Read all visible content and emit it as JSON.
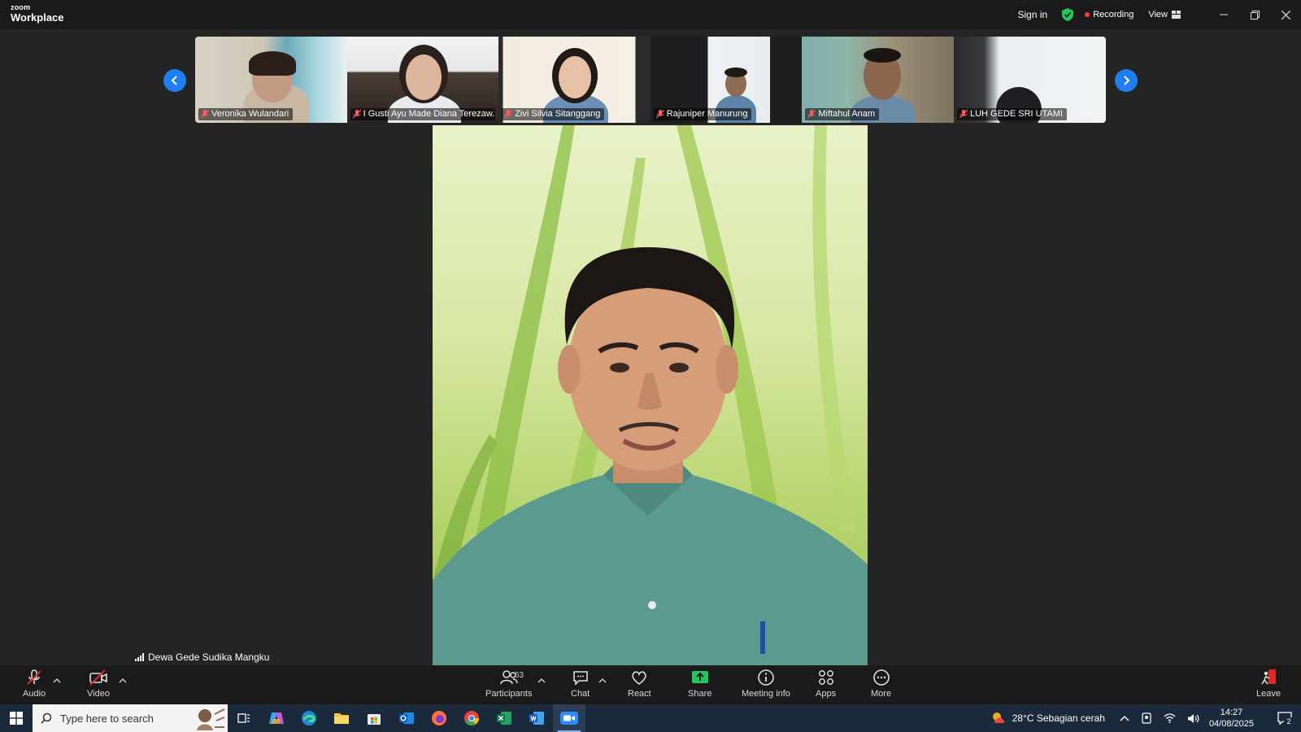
{
  "app": {
    "logo_line1": "zoom",
    "logo_line2": "Workplace"
  },
  "titlebar": {
    "sign_in": "Sign in",
    "recording": "Recording",
    "view": "View"
  },
  "participants_strip": [
    {
      "name": "Veronika Wulandari"
    },
    {
      "name": "I Gusti Ayu Made Diana Terezaw..."
    },
    {
      "name": "Zivi Silvia Sitanggang"
    },
    {
      "name": "Rajuniper Manurung"
    },
    {
      "name": "Miftahul Anam"
    },
    {
      "name": "LUH GEDE SRI UTAMI"
    }
  ],
  "active_speaker": {
    "name": "Dewa Gede Sudika Mangku"
  },
  "toolbar": {
    "audio": "Audio",
    "video": "Video",
    "participants": "Participants",
    "participants_count": "63",
    "chat": "Chat",
    "react": "React",
    "share": "Share",
    "meeting_info": "Meeting info",
    "apps": "Apps",
    "more": "More",
    "leave": "Leave"
  },
  "taskbar": {
    "search_placeholder": "Type here to search",
    "weather": "28°C  Sebagian cerah",
    "time": "14:27",
    "date": "04/08/2025",
    "notification_count": "2"
  },
  "colors": {
    "accent": "#1f7ef2",
    "share_green": "#22c55e",
    "record_red": "#ff3b3b",
    "leave_red": "#e02828"
  }
}
